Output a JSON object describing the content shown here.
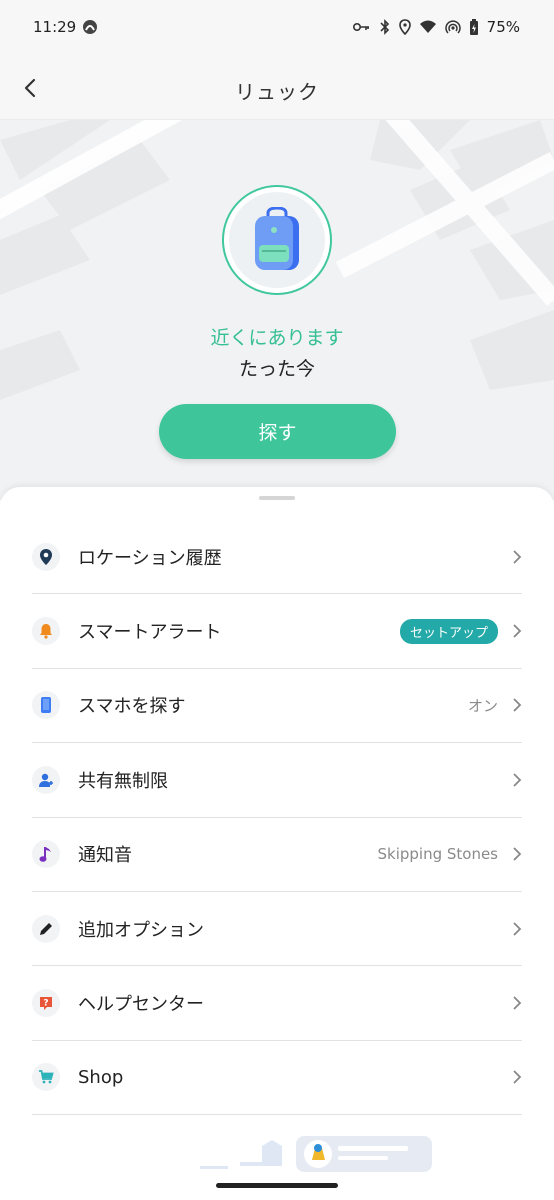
{
  "status_bar": {
    "time": "11:29",
    "battery": "75%"
  },
  "header": {
    "title": "リュック"
  },
  "hero": {
    "status": "近くにあります",
    "time_ago": "たった今",
    "find_button": "探す"
  },
  "menu": {
    "items": [
      {
        "label": "ロケーション履歴",
        "icon": "location-pin-icon",
        "icon_color": "#1f3b57"
      },
      {
        "label": "スマートアラート",
        "icon": "bell-icon",
        "icon_color": "#f08a1c",
        "badge": "セットアップ"
      },
      {
        "label": "スマホを探す",
        "icon": "phone-icon",
        "icon_color": "#3f7df5",
        "value": "オン"
      },
      {
        "label": "共有無制限",
        "icon": "share-user-icon",
        "icon_color": "#2f6fdd"
      },
      {
        "label": "通知音",
        "icon": "music-note-icon",
        "icon_color": "#7b2fbf",
        "value": "Skipping Stones"
      },
      {
        "label": "追加オプション",
        "icon": "pencil-icon",
        "icon_color": "#222222"
      },
      {
        "label": "ヘルプセンター",
        "icon": "help-icon",
        "icon_color": "#e8563a"
      },
      {
        "label": "Shop",
        "icon": "cart-icon",
        "icon_color": "#2bb3b9"
      }
    ]
  },
  "colors": {
    "accent": "#3ec69a",
    "badge": "#23a9a8"
  }
}
